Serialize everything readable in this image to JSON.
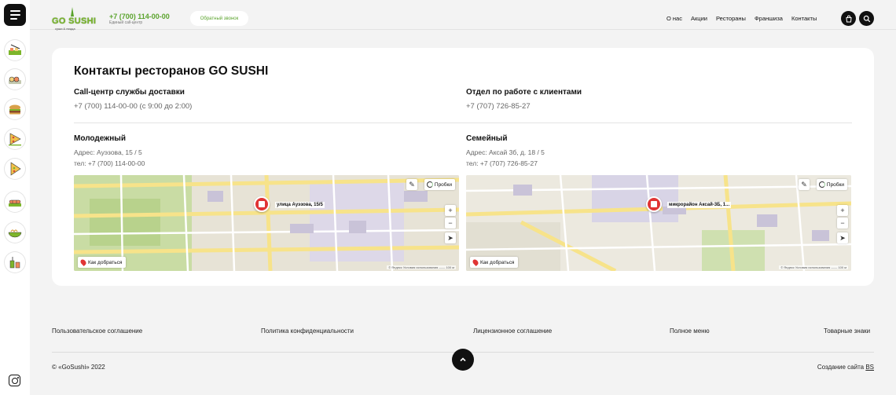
{
  "header": {
    "logo_text": "GO SUSHI",
    "logo_sub": "суши & пицца",
    "phone": "+7 (700) 114-00-00",
    "phone_sub": "Единый call-центр",
    "callback_label": "Обратный звонок",
    "nav": [
      "О нас",
      "Акции",
      "Рестораны",
      "Франшиза",
      "Контакты"
    ],
    "cart_icon": "bag-icon",
    "search_icon": "search-icon"
  },
  "sidebar": {
    "menu_icon": "hamburger-menu-icon",
    "categories": [
      "sushi-set-icon",
      "rolls-icon",
      "burger-icon",
      "pizza-icon",
      "pizza-slice-icon",
      "hot-rolls-icon",
      "noodles-icon",
      "drinks-icon"
    ],
    "social_icon": "instagram-icon"
  },
  "main": {
    "title": "Контакты ресторанов GO SUSHI",
    "contacts": [
      {
        "heading": "Call-центр службы доставки",
        "value": "+7 (700) 114-00-00 (с 9:00 до 2:00)"
      },
      {
        "heading": "Отдел по работе с клиентами",
        "value": "+7 (707) 726-85-27"
      }
    ],
    "restaurants": [
      {
        "name": "Молодежный",
        "address": "Адрес: Ауэзова, 15 / 5",
        "phone": "тел: +7 (700) 114-00-00",
        "map_label": "улица Ауэзова, 15/5"
      },
      {
        "name": "Семейный",
        "address": "Адрес: Аксай 3б, д. 18 / 5",
        "phone": "тел: +7 (707) 726-85-27",
        "map_label": "микрорайон Аксай-3Б, 1..."
      }
    ],
    "map_ui": {
      "traffic": "Пробки",
      "route": "Как добраться",
      "zoom_in": "+",
      "zoom_out": "−",
      "footer": "© Яндекс   Условия использования   ——  100 м"
    }
  },
  "footer": {
    "links": [
      "Пользовательское соглашение",
      "Политика конфиденциальности",
      "Лицензионное соглашение",
      "Полное меню",
      "Товарные знаки"
    ],
    "copyright": "© «GoSushi» 2022",
    "made_by_prefix": "Создание сайта",
    "made_by_link": "BS",
    "up_icon": "arrow-up-icon"
  }
}
